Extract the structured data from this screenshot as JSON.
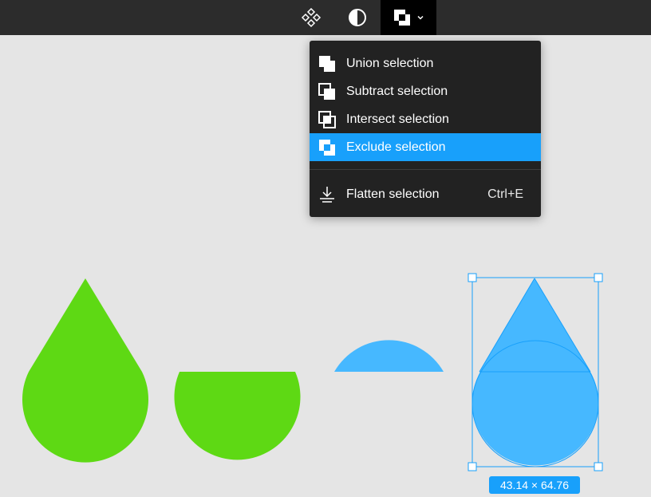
{
  "toolbar": {
    "components_icon": "components-icon",
    "mask_icon": "mask-icon",
    "boolean_icon": "boolean-exclude-icon",
    "dropdown_icon": "chevron-down-icon"
  },
  "boolean_menu": {
    "items": [
      {
        "label": "Union selection",
        "icon": "union-icon",
        "shortcut": ""
      },
      {
        "label": "Subtract selection",
        "icon": "subtract-icon",
        "shortcut": ""
      },
      {
        "label": "Intersect selection",
        "icon": "intersect-icon",
        "shortcut": ""
      },
      {
        "label": "Exclude selection",
        "icon": "exclude-icon",
        "shortcut": "",
        "active": true
      }
    ],
    "flatten": {
      "label": "Flatten selection",
      "icon": "flatten-icon",
      "shortcut": "Ctrl+E"
    }
  },
  "canvas": {
    "selection_size": "43.14 × 64.76",
    "colors": {
      "green_shape": "#5ed914",
      "blue_shape": "#46b8ff",
      "selection": "#18a0fb"
    }
  }
}
